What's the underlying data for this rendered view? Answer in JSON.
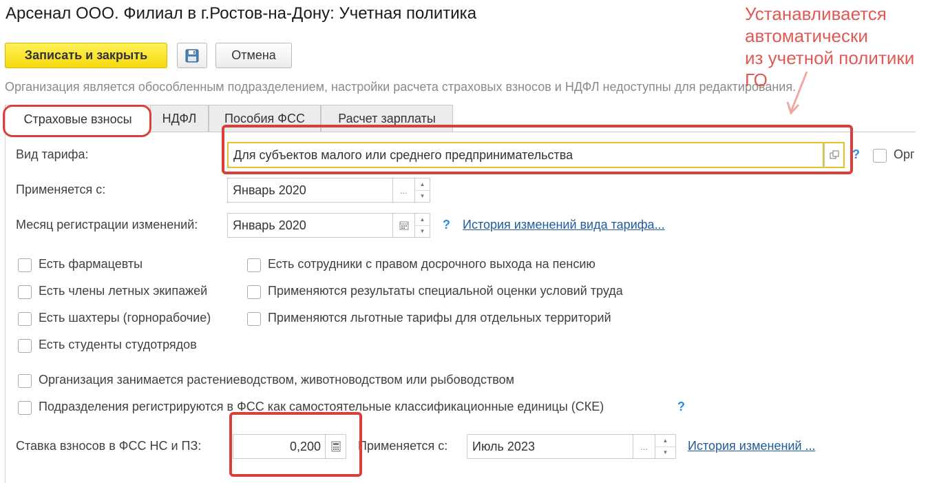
{
  "window": {
    "title": "Арсенал ООО. Филиал в г.Ростов-на-Дону: Учетная политика"
  },
  "toolbar": {
    "save_close_label": "Записать и закрыть",
    "save_icon": "floppy-disk-icon",
    "cancel_label": "Отмена"
  },
  "info_text": "Организация является обособленным подразделением, настройки расчета страховых взносов и НДФЛ недоступны для редактирования.",
  "tabs": [
    {
      "label": "Страховые взносы",
      "active": true
    },
    {
      "label": "НДФЛ",
      "active": false
    },
    {
      "label": "Пособия ФСС",
      "active": false
    },
    {
      "label": "Расчет зарплаты",
      "active": false
    }
  ],
  "tariff": {
    "label": "Вид тарифа:",
    "value": "Для субъектов малого или среднего предпринимательства",
    "help": "?",
    "extra_checkbox_label": "Орг"
  },
  "applies_from": {
    "label": "Применяется с:",
    "value": "Январь 2020",
    "button": "..."
  },
  "registration_month": {
    "label": "Месяц регистрации изменений:",
    "value": "Январь 2020",
    "help": "?",
    "history_link": "История изменений вида тарифа..."
  },
  "checkboxes_left": [
    {
      "label": "Есть фармацевты",
      "checked": false
    },
    {
      "label": "Есть члены летных экипажей",
      "checked": false
    },
    {
      "label": "Есть шахтеры (горнорабочие)",
      "checked": false
    },
    {
      "label": "Есть студенты студотрядов",
      "checked": false
    }
  ],
  "checkboxes_right": [
    {
      "label": "Есть сотрудники с правом досрочного выхода на пенсию",
      "checked": false
    },
    {
      "label": "Применяются результаты специальной оценки условий труда",
      "checked": false
    },
    {
      "label": "Применяются льготные тарифы для отдельных территорий",
      "checked": false
    }
  ],
  "checkboxes_bottom": [
    {
      "label": "Организация занимается растениеводством, животноводством или рыбоводством",
      "checked": false
    },
    {
      "label": "Подразделения регистрируются в ФСС как самостоятельные классификационные единицы (СКЕ)",
      "checked": false
    }
  ],
  "ske_help": "?",
  "fss_rate": {
    "label": "Ставка взносов в ФСС НС и ПЗ:",
    "value": "0,200",
    "applies_label": "Применяется с:",
    "applies_value": "Июль 2023",
    "button": "...",
    "history_link": "История изменений ..."
  },
  "annotation": {
    "lines": [
      "Устанавливается",
      "автоматически",
      "из учетной политики",
      "ГО"
    ],
    "color": "#d9403a"
  }
}
